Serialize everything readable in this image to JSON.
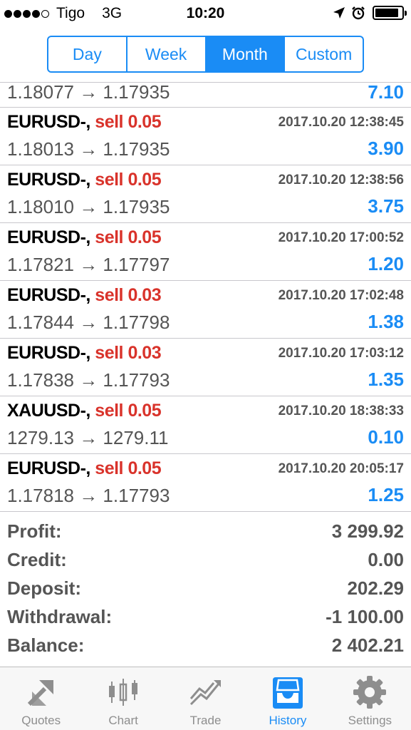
{
  "status_bar": {
    "carrier": "Tigo",
    "network": "3G",
    "time": "10:20",
    "signal_bars": 4,
    "signal_max": 5,
    "battery_level": 0.9
  },
  "period_tabs": [
    {
      "label": "Day",
      "active": false
    },
    {
      "label": "Week",
      "active": false
    },
    {
      "label": "Month",
      "active": true
    },
    {
      "label": "Custom",
      "active": false
    }
  ],
  "partial_row": {
    "prices": "1.18077 → 1.17935",
    "profit": "7.10"
  },
  "deals": [
    {
      "symbol": "EURUSD-,",
      "side": "sell 0.05",
      "time": "2017.10.20 12:38:45",
      "prices": "1.18013 → 1.17935",
      "profit": "3.90"
    },
    {
      "symbol": "EURUSD-,",
      "side": "sell 0.05",
      "time": "2017.10.20 12:38:56",
      "prices": "1.18010 → 1.17935",
      "profit": "3.75"
    },
    {
      "symbol": "EURUSD-,",
      "side": "sell 0.05",
      "time": "2017.10.20 17:00:52",
      "prices": "1.17821 → 1.17797",
      "profit": "1.20"
    },
    {
      "symbol": "EURUSD-,",
      "side": "sell 0.03",
      "time": "2017.10.20 17:02:48",
      "prices": "1.17844 → 1.17798",
      "profit": "1.38"
    },
    {
      "symbol": "EURUSD-,",
      "side": "sell 0.03",
      "time": "2017.10.20 17:03:12",
      "prices": "1.17838 → 1.17793",
      "profit": "1.35"
    },
    {
      "symbol": "XAUUSD-,",
      "side": "sell 0.05",
      "time": "2017.10.20 18:38:33",
      "prices": "1279.13 → 1279.11",
      "profit": "0.10"
    },
    {
      "symbol": "EURUSD-,",
      "side": "sell 0.05",
      "time": "2017.10.20 20:05:17",
      "prices": "1.17818 → 1.17793",
      "profit": "1.25"
    }
  ],
  "summary": [
    {
      "label": "Profit:",
      "value": "3 299.92"
    },
    {
      "label": "Credit:",
      "value": "0.00"
    },
    {
      "label": "Deposit:",
      "value": "202.29"
    },
    {
      "label": "Withdrawal:",
      "value": "-1 100.00"
    },
    {
      "label": "Balance:",
      "value": "2 402.21"
    }
  ],
  "tab_bar": [
    {
      "label": "Quotes",
      "icon": "quotes-icon",
      "active": false
    },
    {
      "label": "Chart",
      "icon": "candlestick-chart-icon",
      "active": false
    },
    {
      "label": "Trade",
      "icon": "trade-icon",
      "active": false
    },
    {
      "label": "History",
      "icon": "history-inbox-icon",
      "active": true
    },
    {
      "label": "Settings",
      "icon": "gear-icon",
      "active": false
    }
  ],
  "colors": {
    "accent": "#1a8cf5",
    "sell": "#d9332b",
    "muted_text": "#555555",
    "tab_inactive": "#8e8e8e"
  }
}
